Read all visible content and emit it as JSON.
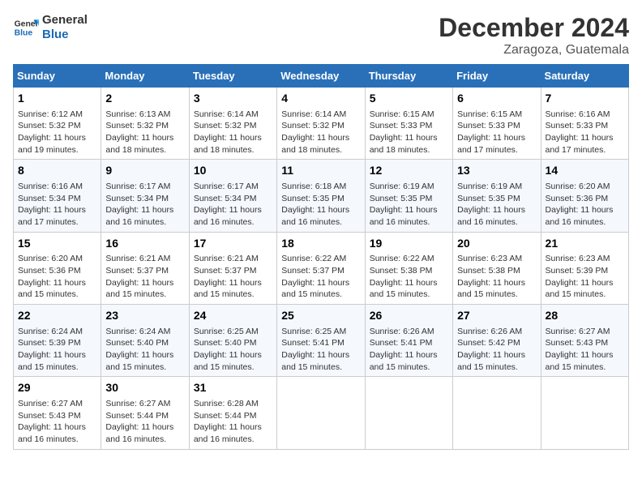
{
  "header": {
    "logo_line1": "General",
    "logo_line2": "Blue",
    "month": "December 2024",
    "location": "Zaragoza, Guatemala"
  },
  "weekdays": [
    "Sunday",
    "Monday",
    "Tuesday",
    "Wednesday",
    "Thursday",
    "Friday",
    "Saturday"
  ],
  "weeks": [
    [
      {
        "day": "1",
        "sunrise": "6:12 AM",
        "sunset": "5:32 PM",
        "daylight": "11 hours and 19 minutes."
      },
      {
        "day": "2",
        "sunrise": "6:13 AM",
        "sunset": "5:32 PM",
        "daylight": "11 hours and 18 minutes."
      },
      {
        "day": "3",
        "sunrise": "6:14 AM",
        "sunset": "5:32 PM",
        "daylight": "11 hours and 18 minutes."
      },
      {
        "day": "4",
        "sunrise": "6:14 AM",
        "sunset": "5:32 PM",
        "daylight": "11 hours and 18 minutes."
      },
      {
        "day": "5",
        "sunrise": "6:15 AM",
        "sunset": "5:33 PM",
        "daylight": "11 hours and 18 minutes."
      },
      {
        "day": "6",
        "sunrise": "6:15 AM",
        "sunset": "5:33 PM",
        "daylight": "11 hours and 17 minutes."
      },
      {
        "day": "7",
        "sunrise": "6:16 AM",
        "sunset": "5:33 PM",
        "daylight": "11 hours and 17 minutes."
      }
    ],
    [
      {
        "day": "8",
        "sunrise": "6:16 AM",
        "sunset": "5:34 PM",
        "daylight": "11 hours and 17 minutes."
      },
      {
        "day": "9",
        "sunrise": "6:17 AM",
        "sunset": "5:34 PM",
        "daylight": "11 hours and 16 minutes."
      },
      {
        "day": "10",
        "sunrise": "6:17 AM",
        "sunset": "5:34 PM",
        "daylight": "11 hours and 16 minutes."
      },
      {
        "day": "11",
        "sunrise": "6:18 AM",
        "sunset": "5:35 PM",
        "daylight": "11 hours and 16 minutes."
      },
      {
        "day": "12",
        "sunrise": "6:19 AM",
        "sunset": "5:35 PM",
        "daylight": "11 hours and 16 minutes."
      },
      {
        "day": "13",
        "sunrise": "6:19 AM",
        "sunset": "5:35 PM",
        "daylight": "11 hours and 16 minutes."
      },
      {
        "day": "14",
        "sunrise": "6:20 AM",
        "sunset": "5:36 PM",
        "daylight": "11 hours and 16 minutes."
      }
    ],
    [
      {
        "day": "15",
        "sunrise": "6:20 AM",
        "sunset": "5:36 PM",
        "daylight": "11 hours and 15 minutes."
      },
      {
        "day": "16",
        "sunrise": "6:21 AM",
        "sunset": "5:37 PM",
        "daylight": "11 hours and 15 minutes."
      },
      {
        "day": "17",
        "sunrise": "6:21 AM",
        "sunset": "5:37 PM",
        "daylight": "11 hours and 15 minutes."
      },
      {
        "day": "18",
        "sunrise": "6:22 AM",
        "sunset": "5:37 PM",
        "daylight": "11 hours and 15 minutes."
      },
      {
        "day": "19",
        "sunrise": "6:22 AM",
        "sunset": "5:38 PM",
        "daylight": "11 hours and 15 minutes."
      },
      {
        "day": "20",
        "sunrise": "6:23 AM",
        "sunset": "5:38 PM",
        "daylight": "11 hours and 15 minutes."
      },
      {
        "day": "21",
        "sunrise": "6:23 AM",
        "sunset": "5:39 PM",
        "daylight": "11 hours and 15 minutes."
      }
    ],
    [
      {
        "day": "22",
        "sunrise": "6:24 AM",
        "sunset": "5:39 PM",
        "daylight": "11 hours and 15 minutes."
      },
      {
        "day": "23",
        "sunrise": "6:24 AM",
        "sunset": "5:40 PM",
        "daylight": "11 hours and 15 minutes."
      },
      {
        "day": "24",
        "sunrise": "6:25 AM",
        "sunset": "5:40 PM",
        "daylight": "11 hours and 15 minutes."
      },
      {
        "day": "25",
        "sunrise": "6:25 AM",
        "sunset": "5:41 PM",
        "daylight": "11 hours and 15 minutes."
      },
      {
        "day": "26",
        "sunrise": "6:26 AM",
        "sunset": "5:41 PM",
        "daylight": "11 hours and 15 minutes."
      },
      {
        "day": "27",
        "sunrise": "6:26 AM",
        "sunset": "5:42 PM",
        "daylight": "11 hours and 15 minutes."
      },
      {
        "day": "28",
        "sunrise": "6:27 AM",
        "sunset": "5:43 PM",
        "daylight": "11 hours and 15 minutes."
      }
    ],
    [
      {
        "day": "29",
        "sunrise": "6:27 AM",
        "sunset": "5:43 PM",
        "daylight": "11 hours and 16 minutes."
      },
      {
        "day": "30",
        "sunrise": "6:27 AM",
        "sunset": "5:44 PM",
        "daylight": "11 hours and 16 minutes."
      },
      {
        "day": "31",
        "sunrise": "6:28 AM",
        "sunset": "5:44 PM",
        "daylight": "11 hours and 16 minutes."
      },
      null,
      null,
      null,
      null
    ]
  ]
}
